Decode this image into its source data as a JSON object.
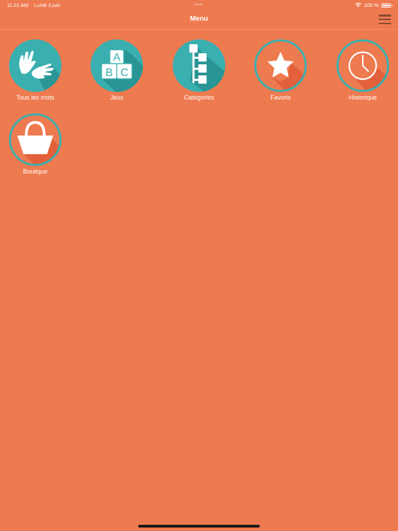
{
  "status_bar": {
    "time": "11:21 AM",
    "date": "Lundi 3 juin",
    "battery_text": "100 %",
    "wifi_icon": "wifi-icon",
    "battery_icon": "battery-icon"
  },
  "nav": {
    "title": "Menu",
    "menu_icon": "hamburger-menu-icon"
  },
  "tiles": [
    {
      "label": "Tous les mots",
      "icon": "signing-hands-icon",
      "style": "filled"
    },
    {
      "label": "Jeux",
      "icon": "abc-blocks-icon",
      "style": "filled"
    },
    {
      "label": "Catégories",
      "icon": "category-tree-icon",
      "style": "filled"
    },
    {
      "label": "Favoris",
      "icon": "star-icon",
      "style": "outlined"
    },
    {
      "label": "Historique",
      "icon": "clock-icon",
      "style": "outlined"
    },
    {
      "label": "Boutique",
      "icon": "shopping-basket-icon",
      "style": "outlined"
    }
  ],
  "colors": {
    "background": "#EE7A50",
    "teal": "#3AAFAF",
    "teal_dark": "#2A9595",
    "shadow": "#E2603A",
    "text": "#FFFFFF"
  }
}
